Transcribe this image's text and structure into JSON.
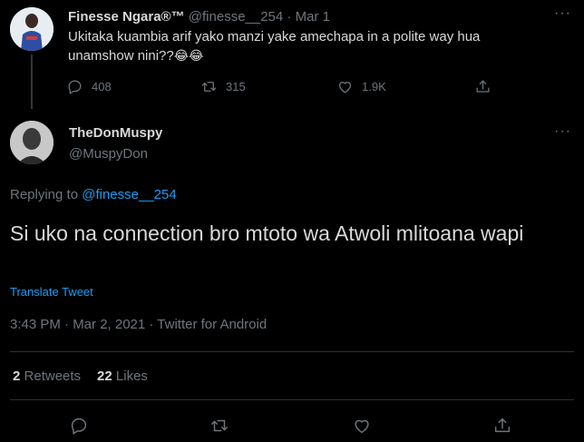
{
  "parent_tweet": {
    "display_name": "Finesse Ngara®™",
    "handle": "@finesse__254",
    "separator": "·",
    "date": "Mar 1",
    "text": "Ukitaka kuambia arif yako manzi yake amechapa in a polite way hua unamshow nini??",
    "emojis": "😂😂",
    "reply_count": "408",
    "retweet_count": "315",
    "like_count": "1.9K",
    "more_label": "···"
  },
  "main_tweet": {
    "display_name": "TheDonMuspy",
    "handle": "@MuspyDon",
    "more_label": "···",
    "replying_prefix": "Replying to ",
    "replying_handle": "@finesse__254",
    "text": "Si uko na connection bro mtoto wa Atwoli mlitoana wapi",
    "translate_label": "Translate Tweet",
    "timestamp": "3:43 PM · Mar 2, 2021 · Twitter for Android",
    "retweets_count": "2",
    "retweets_label": "Retweets",
    "likes_count": "22",
    "likes_label": "Likes"
  },
  "colors": {
    "background": "#000000",
    "text": "#d9d9d9",
    "muted": "#6e767d",
    "link": "#1d9bf0",
    "divider": "#2f3336"
  },
  "icons": {
    "reply": "reply-icon",
    "retweet": "retweet-icon",
    "like": "like-icon",
    "share": "share-icon",
    "more": "more-icon"
  }
}
